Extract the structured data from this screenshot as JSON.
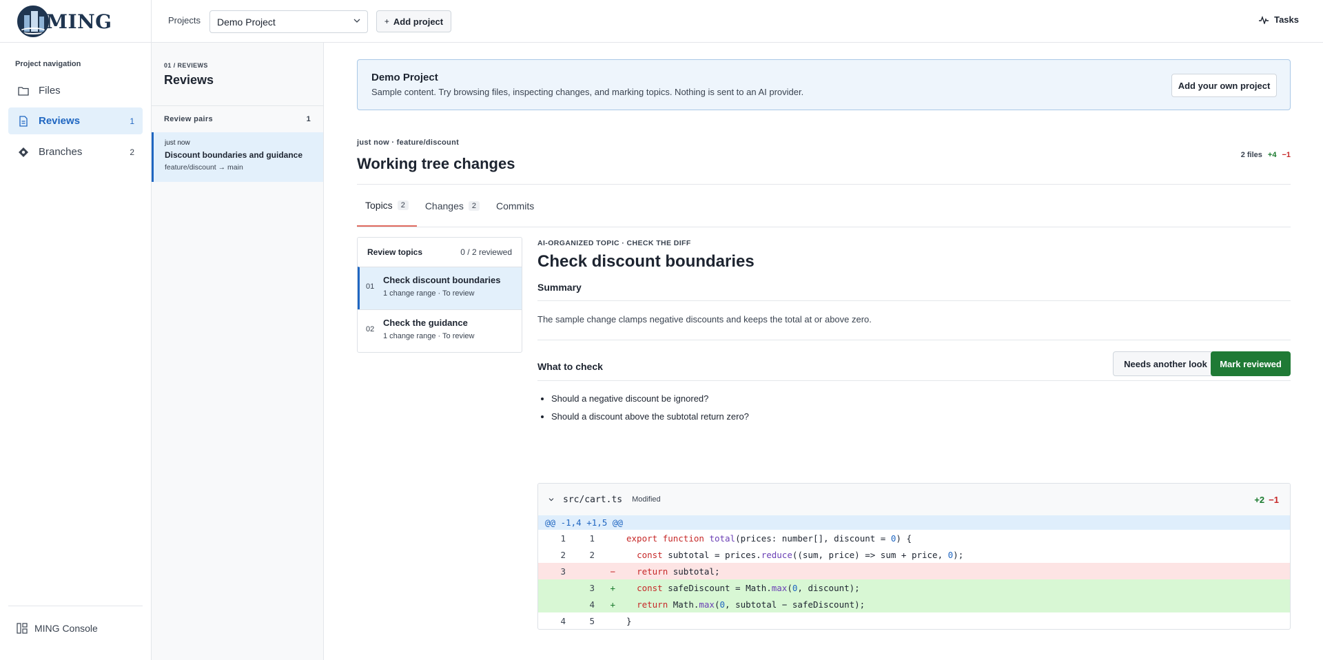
{
  "brand": {
    "name": "MING"
  },
  "topbar": {
    "projects_label": "Projects",
    "project_selected": "Demo Project",
    "add_project_label": "Add project",
    "tasks_label": "Tasks"
  },
  "sidebar": {
    "title": "Project navigation",
    "items": [
      {
        "label": "Files",
        "icon": "folder-icon",
        "count": ""
      },
      {
        "label": "Reviews",
        "icon": "document-icon",
        "count": "1"
      },
      {
        "label": "Branches",
        "icon": "diamond-icon",
        "count": "2"
      }
    ],
    "console_label": "MING Console"
  },
  "reviews": {
    "kicker": "01 / REVIEWS",
    "title": "Reviews",
    "pairs_label": "Review pairs",
    "pairs_count": "1",
    "pair": {
      "time": "just now",
      "title": "Discount boundaries and guidance",
      "branch": "feature/discount → main"
    }
  },
  "banner": {
    "title": "Demo Project",
    "text": "Sample content. Try browsing files, inspecting changes, and marking topics. Nothing is sent to an AI provider.",
    "button": "Add your own project"
  },
  "worktree": {
    "meta": "just now · feature/discount",
    "title": "Working tree changes",
    "files": "2 files",
    "additions": "+4",
    "deletions": "−1"
  },
  "tabs": [
    {
      "label": "Topics",
      "badge": "2"
    },
    {
      "label": "Changes",
      "badge": "2"
    },
    {
      "label": "Commits",
      "badge": ""
    }
  ],
  "topics_panel": {
    "title": "Review topics",
    "progress": "0 / 2 reviewed",
    "items": [
      {
        "num": "01",
        "title": "Check discount boundaries",
        "sub": "1 change range · To review"
      },
      {
        "num": "02",
        "title": "Check the guidance",
        "sub": "1 change range · To review"
      }
    ]
  },
  "detail": {
    "kicker": "AI-ORGANIZED TOPIC · CHECK THE DIFF",
    "title": "Check discount boundaries",
    "summary_heading": "Summary",
    "summary_text": "The sample change clamps negative discounts and keeps the total at or above zero.",
    "check_heading": "What to check",
    "needs_look_label": "Needs another look",
    "mark_reviewed_label": "Mark reviewed",
    "questions": [
      "Should a negative discount be ignored?",
      "Should a discount above the subtotal return zero?"
    ]
  },
  "diff": {
    "file": "src/cart.ts",
    "status": "Modified",
    "additions": "+2",
    "deletions": "−1",
    "hunk": "@@ -1,4 +1,5 @@",
    "lines": [
      {
        "old": "1",
        "new": "1",
        "mark": "",
        "code": "export function total(prices: number[], discount = 0) {"
      },
      {
        "old": "2",
        "new": "2",
        "mark": "",
        "code": "  const subtotal = prices.reduce((sum, price) => sum + price, 0);"
      },
      {
        "old": "3",
        "new": "",
        "mark": "−",
        "code": "  return subtotal;"
      },
      {
        "old": "",
        "new": "3",
        "mark": "+",
        "code": "  const safeDiscount = Math.max(0, discount);"
      },
      {
        "old": "",
        "new": "4",
        "mark": "+",
        "code": "  return Math.max(0, subtotal − safeDiscount);"
      },
      {
        "old": "4",
        "new": "5",
        "mark": "",
        "code": "}"
      }
    ]
  },
  "colors": {
    "accent": "#1f66c1",
    "success": "#1f7a35",
    "danger": "#c62828"
  }
}
